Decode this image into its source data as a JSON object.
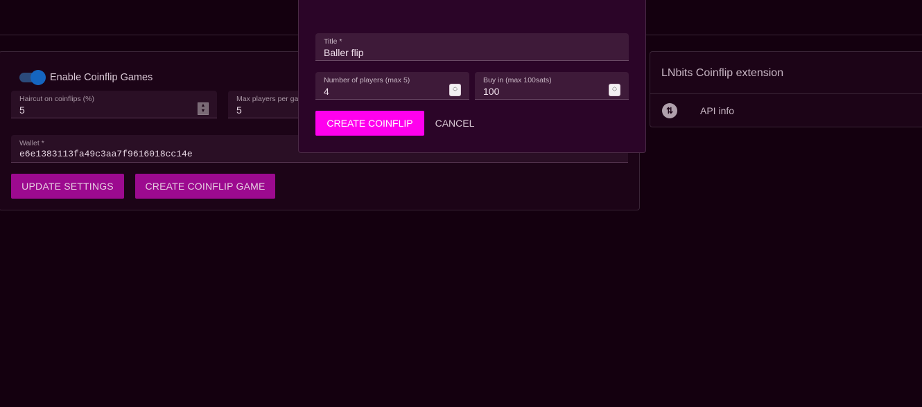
{
  "settings": {
    "toggle_label": "Enable Coinflip Games",
    "haircut_label": "Haircut on coinflips (%)",
    "haircut_value": "5",
    "max_players_label": "Max players per ga",
    "max_players_value": "5",
    "wallet_label": "Wallet *",
    "wallet_value": "e6e1383113fa49c3aa7f9616018cc14e",
    "update_button": "UPDATE SETTINGS",
    "create_game_button": "CREATE COINFLIP GAME"
  },
  "info": {
    "title": "LNbits Coinflip extension",
    "api_label": "API info",
    "api_icon": "swap-vertical-icon"
  },
  "dialog": {
    "title_label": "Title *",
    "title_value": "Baller flip",
    "players_label": "Number of players (max 5)",
    "players_value": "4",
    "buyin_label": "Buy in (max 100sats)",
    "buyin_value": "100",
    "create_button": "CREATE COINFLIP",
    "cancel_button": "CANCEL"
  },
  "colors": {
    "background": "#14000f",
    "accent": "#ff00ee",
    "button": "#9c0a8f",
    "toggle": "#1565c0"
  }
}
